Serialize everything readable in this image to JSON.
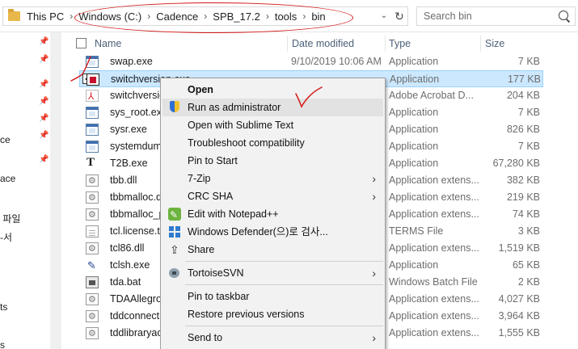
{
  "address_bar": {
    "crumbs": [
      "This PC",
      "Windows (C:)",
      "Cadence",
      "SPB_17.2",
      "tools",
      "bin"
    ],
    "separator": "›",
    "dropdown_glyph": "⌄",
    "refresh_glyph": "↻"
  },
  "search": {
    "placeholder": "Search bin"
  },
  "nav": {
    "items": [
      "ce",
      "ace",
      " 파일",
      "-서",
      "ts",
      "s"
    ]
  },
  "columns": {
    "name": "Name",
    "date": "Date modified",
    "type": "Type",
    "size": "Size"
  },
  "files": [
    {
      "name": "swap.exe",
      "date": "9/10/2019 10:06 AM",
      "type": "Application",
      "size": "7 KB",
      "icon": "exe-icon"
    },
    {
      "name": "switchversion.exe",
      "date": "",
      "type": "Application",
      "size": "177 KB",
      "icon": "red-app-icon",
      "selected": true,
      "checked": "✓"
    },
    {
      "name": "switchversion.pdf",
      "date": "",
      "type": "Adobe Acrobat D...",
      "size": "204 KB",
      "icon": "pdf-icon"
    },
    {
      "name": "sys_root.exe",
      "date": "",
      "type": "Application",
      "size": "7 KB",
      "icon": "exe-icon"
    },
    {
      "name": "sysr.exe",
      "date": "",
      "type": "Application",
      "size": "826 KB",
      "icon": "exe-icon"
    },
    {
      "name": "systemdump.exe",
      "date": "",
      "type": "Application",
      "size": "7 KB",
      "icon": "exe-icon"
    },
    {
      "name": "T2B.exe",
      "date": "",
      "type": "Application",
      "size": "67,280 KB",
      "icon": "t2b-icon"
    },
    {
      "name": "tbb.dll",
      "date": "",
      "type": "Application extens...",
      "size": "382 KB",
      "icon": "dll-icon"
    },
    {
      "name": "tbbmalloc.dll",
      "date": "",
      "type": "Application extens...",
      "size": "219 KB",
      "icon": "dll-icon"
    },
    {
      "name": "tbbmalloc_proxy.dll",
      "date": "",
      "type": "Application extens...",
      "size": "74 KB",
      "icon": "dll-icon"
    },
    {
      "name": "tcl.license.terms",
      "date": "",
      "type": "TERMS File",
      "size": "3 KB",
      "icon": "file-icon"
    },
    {
      "name": "tcl86.dll",
      "date": "",
      "type": "Application extens...",
      "size": "1,519 KB",
      "icon": "dll-icon"
    },
    {
      "name": "tclsh.exe",
      "date": "",
      "type": "Application",
      "size": "65 KB",
      "icon": "feather-icon"
    },
    {
      "name": "tda.bat",
      "date": "",
      "type": "Windows Batch File",
      "size": "2 KB",
      "icon": "bat-icon"
    },
    {
      "name": "TDAAllegro.dll",
      "date": "",
      "type": "Application extens...",
      "size": "4,027 KB",
      "icon": "dll-icon"
    },
    {
      "name": "tddconnect.dll",
      "date": "",
      "type": "Application extens...",
      "size": "3,964 KB",
      "icon": "dll-icon"
    },
    {
      "name": "tddlibraryac.dll",
      "date": "",
      "type": "Application extens...",
      "size": "1,555 KB",
      "icon": "dll-icon"
    }
  ],
  "context_menu": {
    "open": "Open",
    "run_as_admin": "Run as administrator",
    "open_sublime": "Open with Sublime Text",
    "troubleshoot": "Troubleshoot compatibility",
    "pin_start": "Pin to Start",
    "zip": "7-Zip",
    "crc": "CRC SHA",
    "notepadpp": "Edit with Notepad++",
    "defender": "Windows Defender(으)로 검사...",
    "share": "Share",
    "svn": "TortoiseSVN",
    "pin_taskbar": "Pin to taskbar",
    "restore": "Restore previous versions",
    "send_to": "Send to",
    "submenu_glyph": "›"
  },
  "colors": {
    "annotation": "#d41818",
    "selection": "#cce8ff",
    "menu_bg": "#f2f2f2"
  }
}
